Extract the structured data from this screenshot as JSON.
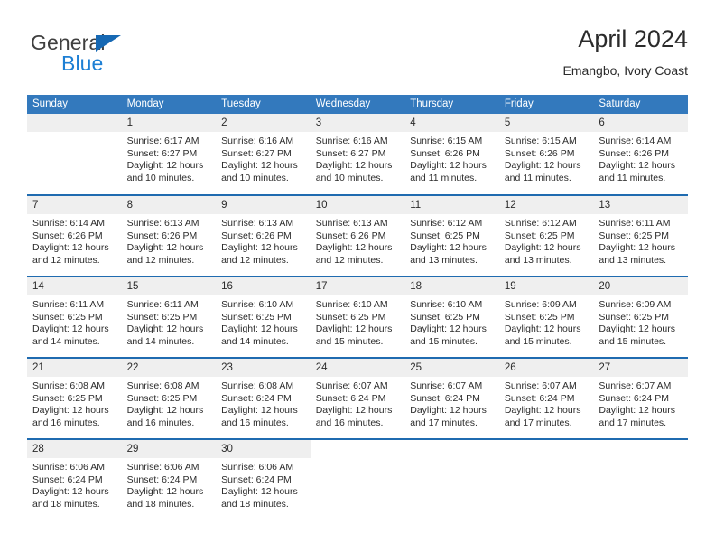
{
  "brand": {
    "name_part1": "General",
    "name_part2": "Blue",
    "accent_color": "#1668b3",
    "blue_text_color": "#1d7fd4"
  },
  "header": {
    "title": "April 2024",
    "location": "Emangbo, Ivory Coast"
  },
  "theme": {
    "header_row_bg": "#3379bd",
    "week_separator": "#1f6bb0",
    "day_band_bg": "#efefef"
  },
  "weekdays": [
    "Sunday",
    "Monday",
    "Tuesday",
    "Wednesday",
    "Thursday",
    "Friday",
    "Saturday"
  ],
  "weeks": [
    [
      {
        "day": "",
        "sunrise": "",
        "sunset": "",
        "daylight_line1": "",
        "daylight_line2": "",
        "state": "empty"
      },
      {
        "day": "1",
        "sunrise": "Sunrise: 6:17 AM",
        "sunset": "Sunset: 6:27 PM",
        "daylight_line1": "Daylight: 12 hours",
        "daylight_line2": "and 10 minutes.",
        "state": "filled"
      },
      {
        "day": "2",
        "sunrise": "Sunrise: 6:16 AM",
        "sunset": "Sunset: 6:27 PM",
        "daylight_line1": "Daylight: 12 hours",
        "daylight_line2": "and 10 minutes.",
        "state": "filled"
      },
      {
        "day": "3",
        "sunrise": "Sunrise: 6:16 AM",
        "sunset": "Sunset: 6:27 PM",
        "daylight_line1": "Daylight: 12 hours",
        "daylight_line2": "and 10 minutes.",
        "state": "filled"
      },
      {
        "day": "4",
        "sunrise": "Sunrise: 6:15 AM",
        "sunset": "Sunset: 6:26 PM",
        "daylight_line1": "Daylight: 12 hours",
        "daylight_line2": "and 11 minutes.",
        "state": "filled"
      },
      {
        "day": "5",
        "sunrise": "Sunrise: 6:15 AM",
        "sunset": "Sunset: 6:26 PM",
        "daylight_line1": "Daylight: 12 hours",
        "daylight_line2": "and 11 minutes.",
        "state": "filled"
      },
      {
        "day": "6",
        "sunrise": "Sunrise: 6:14 AM",
        "sunset": "Sunset: 6:26 PM",
        "daylight_line1": "Daylight: 12 hours",
        "daylight_line2": "and 11 minutes.",
        "state": "filled"
      }
    ],
    [
      {
        "day": "7",
        "sunrise": "Sunrise: 6:14 AM",
        "sunset": "Sunset: 6:26 PM",
        "daylight_line1": "Daylight: 12 hours",
        "daylight_line2": "and 12 minutes.",
        "state": "filled"
      },
      {
        "day": "8",
        "sunrise": "Sunrise: 6:13 AM",
        "sunset": "Sunset: 6:26 PM",
        "daylight_line1": "Daylight: 12 hours",
        "daylight_line2": "and 12 minutes.",
        "state": "filled"
      },
      {
        "day": "9",
        "sunrise": "Sunrise: 6:13 AM",
        "sunset": "Sunset: 6:26 PM",
        "daylight_line1": "Daylight: 12 hours",
        "daylight_line2": "and 12 minutes.",
        "state": "filled"
      },
      {
        "day": "10",
        "sunrise": "Sunrise: 6:13 AM",
        "sunset": "Sunset: 6:26 PM",
        "daylight_line1": "Daylight: 12 hours",
        "daylight_line2": "and 12 minutes.",
        "state": "filled"
      },
      {
        "day": "11",
        "sunrise": "Sunrise: 6:12 AM",
        "sunset": "Sunset: 6:25 PM",
        "daylight_line1": "Daylight: 12 hours",
        "daylight_line2": "and 13 minutes.",
        "state": "filled"
      },
      {
        "day": "12",
        "sunrise": "Sunrise: 6:12 AM",
        "sunset": "Sunset: 6:25 PM",
        "daylight_line1": "Daylight: 12 hours",
        "daylight_line2": "and 13 minutes.",
        "state": "filled"
      },
      {
        "day": "13",
        "sunrise": "Sunrise: 6:11 AM",
        "sunset": "Sunset: 6:25 PM",
        "daylight_line1": "Daylight: 12 hours",
        "daylight_line2": "and 13 minutes.",
        "state": "filled"
      }
    ],
    [
      {
        "day": "14",
        "sunrise": "Sunrise: 6:11 AM",
        "sunset": "Sunset: 6:25 PM",
        "daylight_line1": "Daylight: 12 hours",
        "daylight_line2": "and 14 minutes.",
        "state": "filled"
      },
      {
        "day": "15",
        "sunrise": "Sunrise: 6:11 AM",
        "sunset": "Sunset: 6:25 PM",
        "daylight_line1": "Daylight: 12 hours",
        "daylight_line2": "and 14 minutes.",
        "state": "filled"
      },
      {
        "day": "16",
        "sunrise": "Sunrise: 6:10 AM",
        "sunset": "Sunset: 6:25 PM",
        "daylight_line1": "Daylight: 12 hours",
        "daylight_line2": "and 14 minutes.",
        "state": "filled"
      },
      {
        "day": "17",
        "sunrise": "Sunrise: 6:10 AM",
        "sunset": "Sunset: 6:25 PM",
        "daylight_line1": "Daylight: 12 hours",
        "daylight_line2": "and 15 minutes.",
        "state": "filled"
      },
      {
        "day": "18",
        "sunrise": "Sunrise: 6:10 AM",
        "sunset": "Sunset: 6:25 PM",
        "daylight_line1": "Daylight: 12 hours",
        "daylight_line2": "and 15 minutes.",
        "state": "filled"
      },
      {
        "day": "19",
        "sunrise": "Sunrise: 6:09 AM",
        "sunset": "Sunset: 6:25 PM",
        "daylight_line1": "Daylight: 12 hours",
        "daylight_line2": "and 15 minutes.",
        "state": "filled"
      },
      {
        "day": "20",
        "sunrise": "Sunrise: 6:09 AM",
        "sunset": "Sunset: 6:25 PM",
        "daylight_line1": "Daylight: 12 hours",
        "daylight_line2": "and 15 minutes.",
        "state": "filled"
      }
    ],
    [
      {
        "day": "21",
        "sunrise": "Sunrise: 6:08 AM",
        "sunset": "Sunset: 6:25 PM",
        "daylight_line1": "Daylight: 12 hours",
        "daylight_line2": "and 16 minutes.",
        "state": "filled"
      },
      {
        "day": "22",
        "sunrise": "Sunrise: 6:08 AM",
        "sunset": "Sunset: 6:25 PM",
        "daylight_line1": "Daylight: 12 hours",
        "daylight_line2": "and 16 minutes.",
        "state": "filled"
      },
      {
        "day": "23",
        "sunrise": "Sunrise: 6:08 AM",
        "sunset": "Sunset: 6:24 PM",
        "daylight_line1": "Daylight: 12 hours",
        "daylight_line2": "and 16 minutes.",
        "state": "filled"
      },
      {
        "day": "24",
        "sunrise": "Sunrise: 6:07 AM",
        "sunset": "Sunset: 6:24 PM",
        "daylight_line1": "Daylight: 12 hours",
        "daylight_line2": "and 16 minutes.",
        "state": "filled"
      },
      {
        "day": "25",
        "sunrise": "Sunrise: 6:07 AM",
        "sunset": "Sunset: 6:24 PM",
        "daylight_line1": "Daylight: 12 hours",
        "daylight_line2": "and 17 minutes.",
        "state": "filled"
      },
      {
        "day": "26",
        "sunrise": "Sunrise: 6:07 AM",
        "sunset": "Sunset: 6:24 PM",
        "daylight_line1": "Daylight: 12 hours",
        "daylight_line2": "and 17 minutes.",
        "state": "filled"
      },
      {
        "day": "27",
        "sunrise": "Sunrise: 6:07 AM",
        "sunset": "Sunset: 6:24 PM",
        "daylight_line1": "Daylight: 12 hours",
        "daylight_line2": "and 17 minutes.",
        "state": "filled"
      }
    ],
    [
      {
        "day": "28",
        "sunrise": "Sunrise: 6:06 AM",
        "sunset": "Sunset: 6:24 PM",
        "daylight_line1": "Daylight: 12 hours",
        "daylight_line2": "and 18 minutes.",
        "state": "filled"
      },
      {
        "day": "29",
        "sunrise": "Sunrise: 6:06 AM",
        "sunset": "Sunset: 6:24 PM",
        "daylight_line1": "Daylight: 12 hours",
        "daylight_line2": "and 18 minutes.",
        "state": "filled"
      },
      {
        "day": "30",
        "sunrise": "Sunrise: 6:06 AM",
        "sunset": "Sunset: 6:24 PM",
        "daylight_line1": "Daylight: 12 hours",
        "daylight_line2": "and 18 minutes.",
        "state": "filled"
      },
      {
        "day": "",
        "sunrise": "",
        "sunset": "",
        "daylight_line1": "",
        "daylight_line2": "",
        "state": "blank"
      },
      {
        "day": "",
        "sunrise": "",
        "sunset": "",
        "daylight_line1": "",
        "daylight_line2": "",
        "state": "blank"
      },
      {
        "day": "",
        "sunrise": "",
        "sunset": "",
        "daylight_line1": "",
        "daylight_line2": "",
        "state": "blank"
      },
      {
        "day": "",
        "sunrise": "",
        "sunset": "",
        "daylight_line1": "",
        "daylight_line2": "",
        "state": "blank"
      }
    ]
  ]
}
